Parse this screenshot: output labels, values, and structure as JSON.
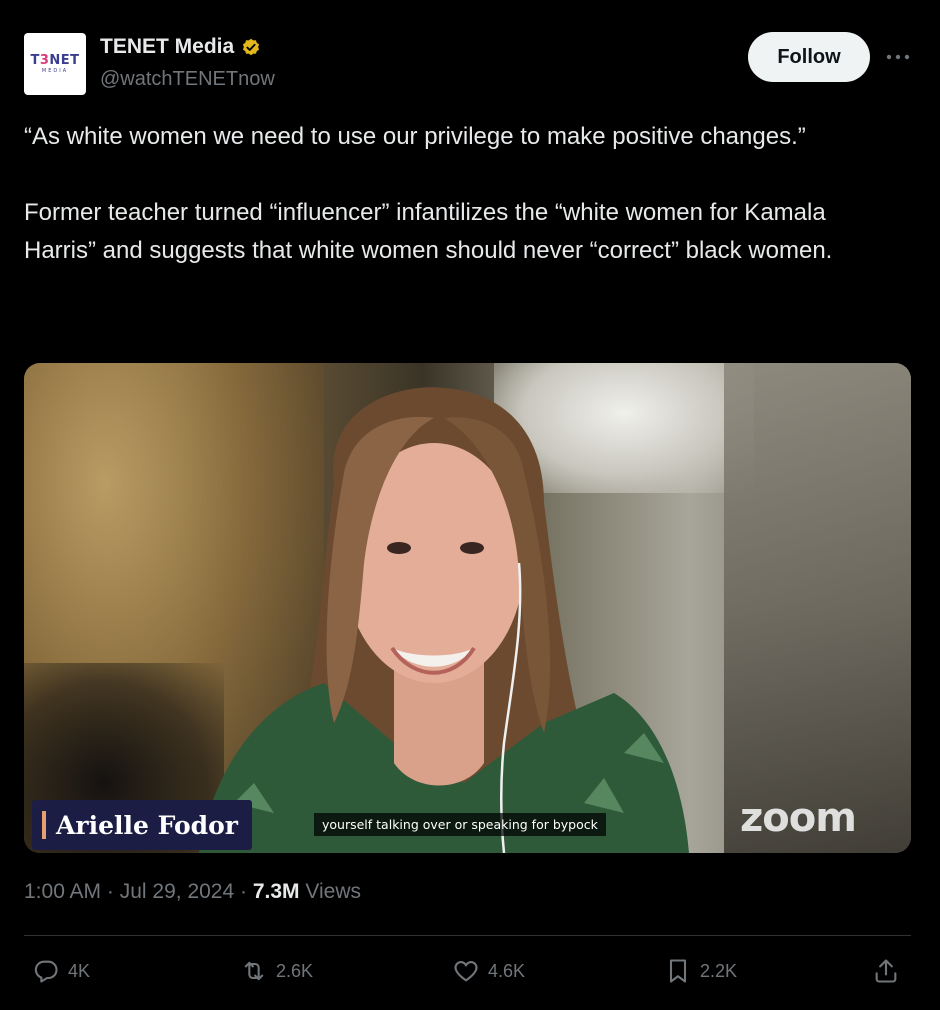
{
  "author": {
    "display_name": "TENET Media",
    "handle": "@watchTENETnow",
    "avatar_logo": "T3NET",
    "avatar_logo_sub": "MEDIA",
    "verified_badge": "gold-verified-icon"
  },
  "follow_label": "Follow",
  "tweet_text": "“As white women we need to use our privilege to make positive changes.”\n\nFormer teacher turned “influencer” infantilizes the “white women for Kamala Harris” and suggests that white women should never “correct” black women.",
  "video": {
    "lower_third_name": "Arielle Fodor",
    "caption": "yourself talking over or speaking for bypock",
    "watermark": "zoom"
  },
  "meta": {
    "time": "1:00 AM",
    "separator": " · ",
    "date": "Jul 29, 2024",
    "views_count": "7.3M",
    "views_label": " Views"
  },
  "actions": {
    "replies": "4K",
    "reposts": "2.6K",
    "likes": "4.6K",
    "bookmarks": "2.2K"
  },
  "colors": {
    "background": "#000000",
    "text_primary": "#e7e9ea",
    "text_secondary": "#71767b",
    "verified_gold": "#e2b719",
    "follow_button_bg": "#eff3f4",
    "lower_third_bg": "#1c1d45"
  }
}
